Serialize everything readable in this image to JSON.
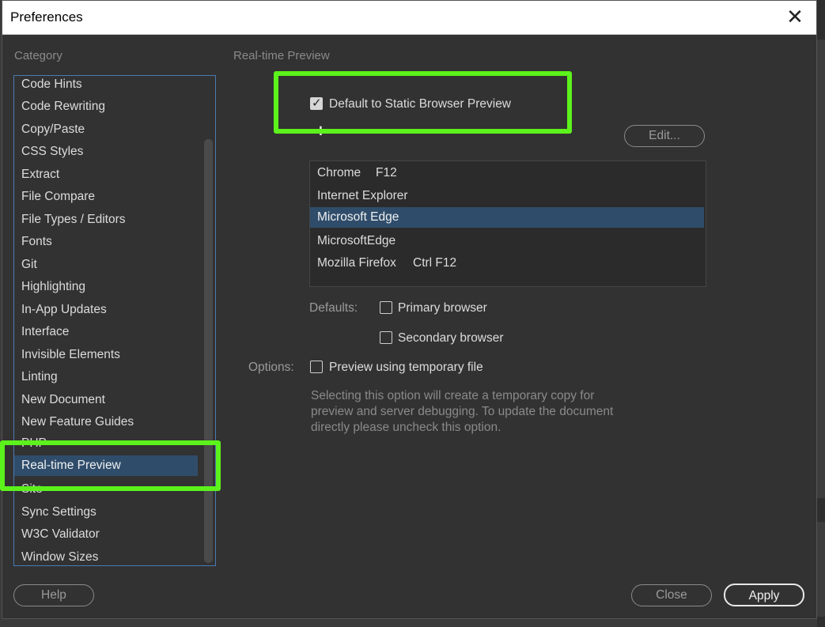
{
  "window": {
    "title": "Preferences"
  },
  "category": {
    "heading": "Category",
    "items": [
      {
        "label": "Code Hints"
      },
      {
        "label": "Code Rewriting"
      },
      {
        "label": "Copy/Paste"
      },
      {
        "label": "CSS Styles"
      },
      {
        "label": "Extract"
      },
      {
        "label": "File Compare"
      },
      {
        "label": "File Types / Editors"
      },
      {
        "label": "Fonts"
      },
      {
        "label": "Git"
      },
      {
        "label": "Highlighting"
      },
      {
        "label": "In-App Updates"
      },
      {
        "label": "Interface"
      },
      {
        "label": "Invisible Elements"
      },
      {
        "label": "Linting"
      },
      {
        "label": "New Document"
      },
      {
        "label": "New Feature Guides"
      },
      {
        "label": "PHP"
      },
      {
        "label": "Real-time Preview"
      },
      {
        "label": "Site"
      },
      {
        "label": "Sync Settings"
      },
      {
        "label": "W3C Validator"
      },
      {
        "label": "Window Sizes"
      }
    ],
    "selected": "Real-time Preview"
  },
  "panel": {
    "title": "Real-time Preview",
    "static_preview_label": "Default to Static Browser Preview",
    "static_preview_checked": true,
    "add_symbol": "+",
    "remove_symbol": "−",
    "edit_label": "Edit...",
    "browsers": [
      {
        "name": "Chrome",
        "shortcut": "F12"
      },
      {
        "name": "Internet Explorer",
        "shortcut": ""
      },
      {
        "name": "Microsoft Edge",
        "shortcut": ""
      },
      {
        "name": "MicrosoftEdge",
        "shortcut": ""
      },
      {
        "name": "Mozilla Firefox",
        "shortcut": "Ctrl F12"
      }
    ],
    "selected_browser": "Microsoft Edge",
    "defaults_label": "Defaults:",
    "primary_browser_label": "Primary browser",
    "secondary_browser_label": "Secondary browser",
    "options_label": "Options:",
    "temp_file_label": "Preview using temporary file",
    "temp_file_description": "Selecting this option will create a temporary copy for preview and server debugging. To update the document directly please uncheck this option."
  },
  "footer": {
    "help_label": "Help",
    "close_label": "Close",
    "apply_label": "Apply"
  },
  "colors": {
    "highlight": "#5cf21b",
    "selection": "#2f4d6b",
    "background": "#323232"
  }
}
